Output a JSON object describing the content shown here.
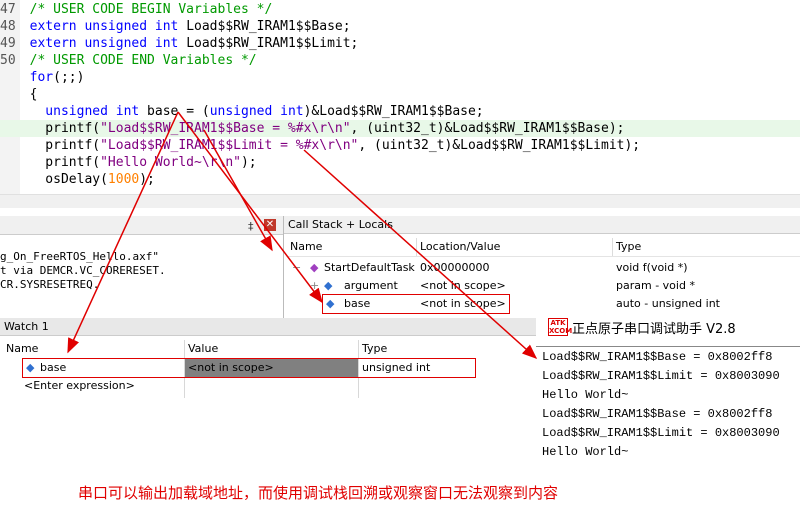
{
  "editor": {
    "lines": [
      {
        "num": "47",
        "parts": [
          {
            "c": "cm",
            "t": "  /* USER CODE BEGIN Variables */"
          }
        ]
      },
      {
        "num": "48",
        "parts": [
          {
            "c": "kw",
            "t": "  extern unsigned int"
          },
          {
            "c": "tx",
            "t": " Load$$RW_IRAM1$$Base;"
          }
        ]
      },
      {
        "num": "49",
        "parts": [
          {
            "c": "kw",
            "t": "  extern unsigned int"
          },
          {
            "c": "tx",
            "t": " Load$$RW_IRAM1$$Limit;"
          }
        ]
      },
      {
        "num": "50",
        "parts": [
          {
            "c": "cm",
            "t": "  /* USER CODE END Variables */"
          }
        ]
      },
      {
        "num": "",
        "parts": [
          {
            "c": "kw",
            "t": "  for"
          },
          {
            "c": "tx",
            "t": "(;;)"
          }
        ]
      },
      {
        "num": "",
        "parts": [
          {
            "c": "tx",
            "t": "  {"
          }
        ]
      },
      {
        "num": "",
        "parts": [
          {
            "c": "kw",
            "t": "    unsigned int"
          },
          {
            "c": "tx",
            "t": " base = ("
          },
          {
            "c": "kw",
            "t": "unsigned int"
          },
          {
            "c": "tx",
            "t": ")&Load$$RW_IRAM1$$Base;"
          }
        ]
      },
      {
        "num": "",
        "parts": [
          {
            "c": "tx",
            "t": "    printf("
          },
          {
            "c": "st",
            "t": "\"Load$$RW_IRAM1$$Base = %#x\\r\\n\""
          },
          {
            "c": "tx",
            "t": ", (uint32_t)&Load$$RW_IRAM1$$Base);"
          }
        ]
      },
      {
        "num": "",
        "parts": [
          {
            "c": "tx",
            "t": "    printf("
          },
          {
            "c": "st",
            "t": "\"Load$$RW_IRAM1$$Limit = %#x\\r\\n\""
          },
          {
            "c": "tx",
            "t": ", (uint32_t)&Load$$RW_IRAM1$$Limit);"
          }
        ]
      },
      {
        "num": "",
        "parts": [
          {
            "c": "tx",
            "t": "    printf("
          },
          {
            "c": "st",
            "t": "\"Hello World~\\r\\n\""
          },
          {
            "c": "tx",
            "t": ");"
          }
        ]
      },
      {
        "num": "",
        "parts": [
          {
            "c": "tx",
            "t": "    osDelay("
          },
          {
            "c": "num",
            "t": "1000"
          },
          {
            "c": "tx",
            "t": ");"
          }
        ]
      }
    ]
  },
  "left_panel": {
    "pin": "‡",
    "close": "✕",
    "output_lines": [
      "g_On_FreeRTOS_Hello.axf\"",
      "t via DEMCR.VC_CORERESET.",
      "CR.SYSRESETREQ."
    ]
  },
  "callstack": {
    "title": "Call Stack + Locals",
    "headers": {
      "name": "Name",
      "location": "Location/Value",
      "type": "Type"
    },
    "rows": [
      {
        "name": "StartDefaultTask",
        "value": "0x00000000",
        "type": "void f(void *)",
        "expander": "−",
        "icon": "◆"
      },
      {
        "name": "argument",
        "value": "<not in scope>",
        "type": "param - void *",
        "expander": "+",
        "icon": "◆"
      },
      {
        "name": "base",
        "value": "<not in scope>",
        "type": "auto - unsigned int",
        "expander": "",
        "icon": "◆"
      }
    ]
  },
  "watch": {
    "title": "Watch 1",
    "headers": {
      "name": "Name",
      "value": "Value",
      "type": "Type"
    },
    "rows": [
      {
        "name": "base",
        "value": "<not in scope>",
        "type": "unsigned int"
      },
      {
        "name": "<Enter expression>",
        "value": "",
        "type": ""
      }
    ]
  },
  "serial": {
    "logo_top": "ATK",
    "logo_bottom": "XCOM",
    "title": "正点原子串口调试助手 V2.8",
    "lines": [
      "Load$$RW_IRAM1$$Base = 0x8002ff8",
      "Load$$RW_IRAM1$$Limit = 0x8003090",
      "Hello World~",
      "Load$$RW_IRAM1$$Base = 0x8002ff8",
      "Load$$RW_IRAM1$$Limit = 0x8003090",
      "Hello World~"
    ]
  },
  "caption": "串口可以输出加载域地址，而使用调试栈回溯或观察窗口无法观察到内容",
  "colors": {
    "annotation": "#e00000",
    "comment": "#009900",
    "keyword": "#0000ff",
    "string": "#800080"
  }
}
